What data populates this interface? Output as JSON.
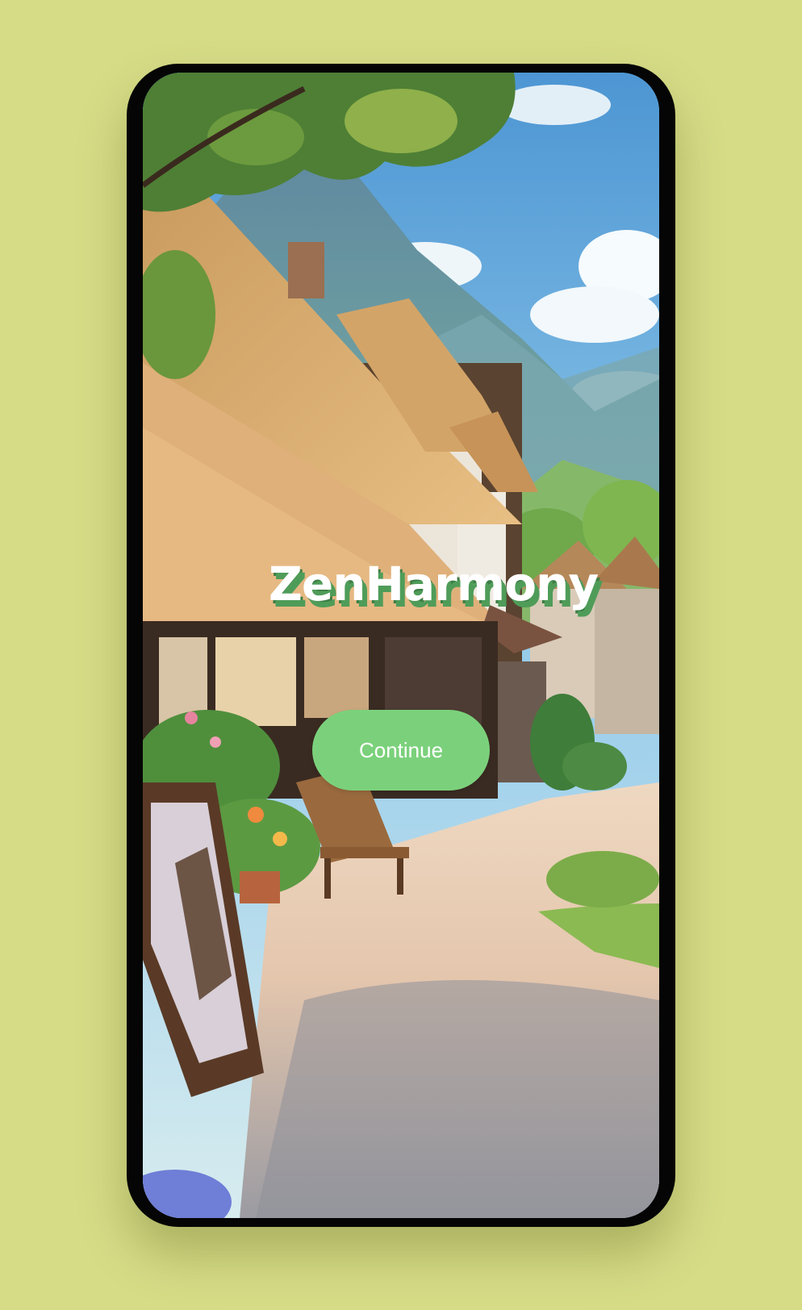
{
  "app": {
    "title": "ZenHarmony"
  },
  "actions": {
    "continue_label": "Continue"
  },
  "theme": {
    "background": "#d6dc86",
    "frame": "#050505",
    "accent": "#7bd17b",
    "title_shadow": "#4f9c59"
  },
  "illustration": {
    "subject": "village street with cottages, mountains and sky"
  }
}
